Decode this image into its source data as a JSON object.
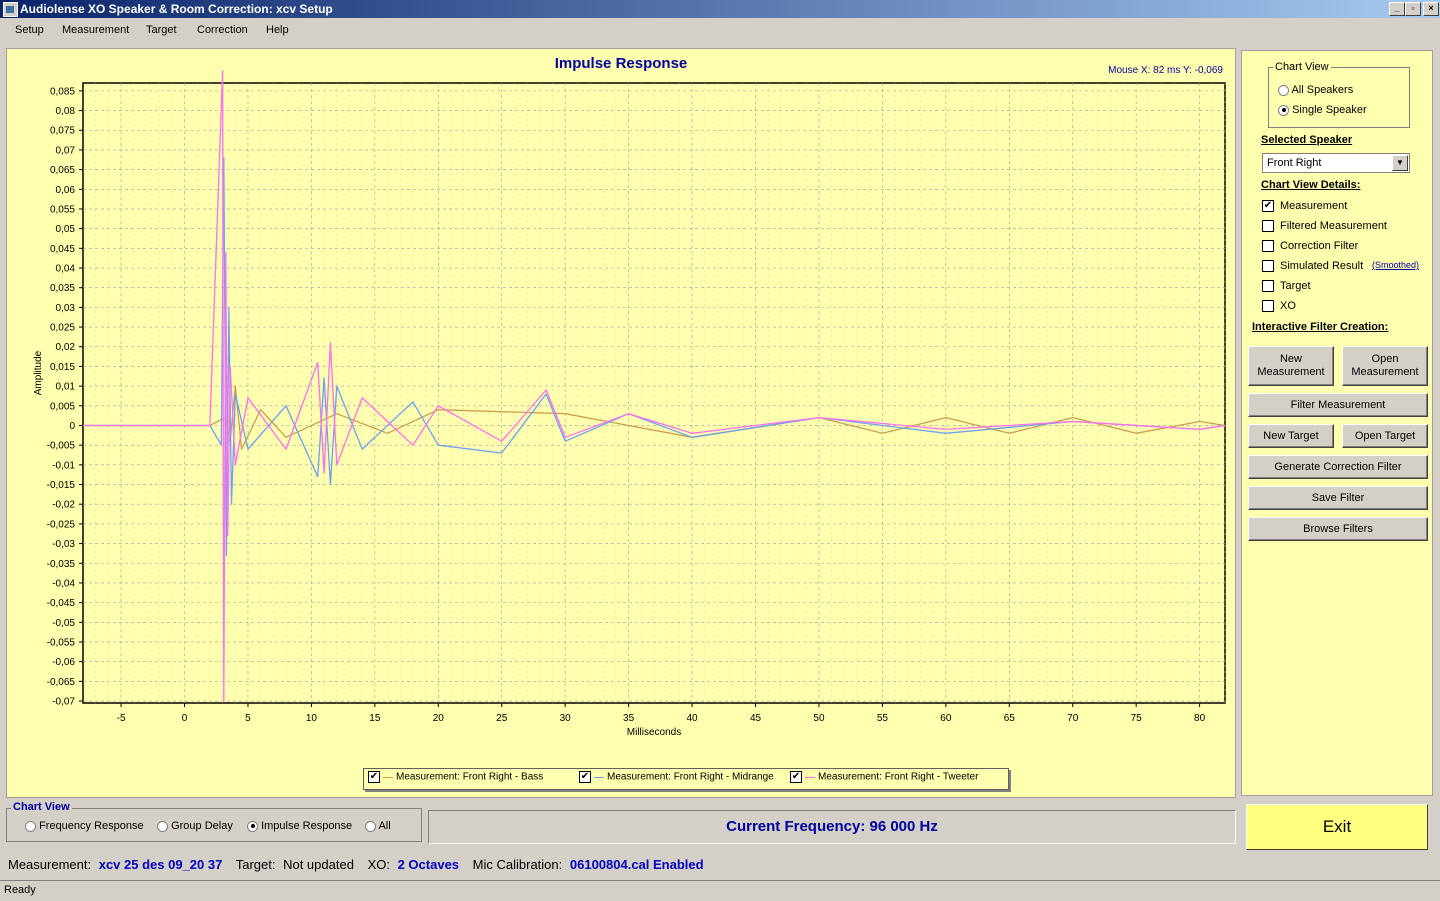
{
  "window": {
    "title": "Audiolense XO Speaker & Room Correction: xcv Setup"
  },
  "menu": {
    "items": [
      "Setup",
      "Measurement",
      "Target",
      "Correction",
      "Help"
    ]
  },
  "chart": {
    "title": "Impulse Response",
    "mouse_readout": "Mouse X: 82 ms   Y: -0,069"
  },
  "chart_data": {
    "type": "line",
    "title": "Impulse Response",
    "xlabel": "Milliseconds",
    "ylabel": "Amplitude",
    "xlim": [
      -8,
      82
    ],
    "ylim": [
      -0.07,
      0.085
    ],
    "grid": true,
    "xticks": [
      "-5",
      "0",
      "5",
      "10",
      "15",
      "20",
      "25",
      "30",
      "35",
      "40",
      "45",
      "50",
      "55",
      "60",
      "65",
      "70",
      "75",
      "80"
    ],
    "yticks": [
      "0,085",
      "0,08",
      "0,075",
      "0,07",
      "0,065",
      "0,06",
      "0,055",
      "0,05",
      "0,045",
      "0,04",
      "0,035",
      "0,03",
      "0,025",
      "0,02",
      "0,015",
      "0,01",
      "0,005",
      "0",
      "-0,005",
      "-0,01",
      "-0,015",
      "-0,02",
      "-0,025",
      "-0,03",
      "-0,035",
      "-0,04",
      "-0,045",
      "-0,05",
      "-0,055",
      "-0,06",
      "-0,065",
      "-0,07"
    ],
    "series": [
      {
        "name": "Measurement: Front Right - Bass",
        "color": "#c8a050",
        "x": [
          -8,
          2,
          3.2,
          3.6,
          4,
          4.5,
          6,
          8,
          12,
          16,
          20,
          30,
          40,
          50,
          55,
          60,
          65,
          70,
          75,
          80,
          82
        ],
        "y": [
          0,
          0,
          0.002,
          -0.004,
          0.01,
          -0.006,
          0.004,
          -0.003,
          0.003,
          -0.002,
          0.004,
          0.003,
          -0.003,
          0.002,
          -0.002,
          0.002,
          -0.002,
          0.002,
          -0.002,
          0.001,
          0
        ]
      },
      {
        "name": "Measurement: Front Right - Midrange",
        "color": "#70a0f0",
        "x": [
          -8,
          2,
          2.9,
          3.1,
          3.3,
          3.5,
          3.7,
          4,
          5,
          8,
          10.5,
          11,
          11.5,
          12,
          14,
          18,
          20,
          25,
          28.5,
          30,
          35,
          40,
          50,
          60,
          70,
          80,
          82
        ],
        "y": [
          0,
          0,
          -0.005,
          0.068,
          -0.033,
          0.03,
          -0.02,
          0.008,
          -0.006,
          0.005,
          -0.013,
          0.012,
          -0.015,
          0.01,
          -0.006,
          0.006,
          -0.005,
          -0.007,
          0.008,
          -0.004,
          0.003,
          -0.003,
          0.002,
          -0.002,
          0.001,
          -0.001,
          0
        ]
      },
      {
        "name": "Measurement: Front Right - Tweeter",
        "color": "#ff70f0",
        "x": [
          -8,
          2,
          3.0,
          3.1,
          3.25,
          3.4,
          3.6,
          4,
          5,
          8,
          10.5,
          11,
          11.5,
          12,
          14,
          18,
          20,
          25,
          28.5,
          30,
          35,
          40,
          50,
          60,
          70,
          80,
          82
        ],
        "y": [
          0,
          0,
          0.09,
          -0.07,
          0.044,
          -0.028,
          0.015,
          -0.01,
          0.007,
          -0.006,
          0.016,
          -0.012,
          0.021,
          -0.01,
          0.007,
          -0.005,
          0.005,
          -0.004,
          0.009,
          -0.003,
          0.003,
          -0.002,
          0.002,
          -0.001,
          0.001,
          -0.001,
          0
        ]
      }
    ]
  },
  "legend": {
    "items": [
      {
        "label": "Measurement: Front Right - Bass",
        "checked": "✔"
      },
      {
        "label": "Measurement: Front Right - Midrange",
        "checked": "✔"
      },
      {
        "label": "Measurement: Front Right - Tweeter",
        "checked": "✔"
      }
    ]
  },
  "right_panel": {
    "chart_view_label": "Chart View",
    "all_speakers": "All Speakers",
    "single_speaker": "Single Speaker",
    "selected_speaker_label": "Selected Speaker",
    "selected_speaker_value": "Front Right",
    "chart_view_details_label": "Chart View Details:",
    "details": [
      {
        "label": "Measurement",
        "checked": "✔"
      },
      {
        "label": "Filtered Measurement",
        "checked": ""
      },
      {
        "label": "Correction Filter",
        "checked": ""
      },
      {
        "label": "Simulated Result",
        "checked": ""
      },
      {
        "label": "Target",
        "checked": ""
      },
      {
        "label": "XO",
        "checked": ""
      }
    ],
    "smoothed_link": "(Smoothed)",
    "interactive_label": "Interactive Filter Creation:",
    "buttons": {
      "new_measurement": "New Measurement",
      "open_measurement": "Open Measurement",
      "filter_measurement": "Filter Measurement",
      "new_target": "New Target",
      "open_target": "Open Target",
      "generate_correction_filter": "Generate Correction Filter",
      "save_filter": "Save Filter",
      "browse_filters": "Browse Filters"
    }
  },
  "bottom": {
    "chart_view_label": "Chart View",
    "options": [
      "Frequency Response",
      "Group Delay",
      "Impulse Response",
      "All"
    ],
    "current_frequency": "Current Frequency: 96 000 Hz",
    "exit_label": "Exit"
  },
  "status_info": {
    "measurement_label": "Measurement:",
    "measurement_value": "xcv 25 des 09_20 37",
    "target_label": "Target:",
    "target_value": "Not updated",
    "xo_label": "XO:",
    "xo_value": "2 Octaves",
    "mic_label": "Mic Calibration:",
    "mic_value": "06100804.cal Enabled"
  },
  "status_bar": {
    "text": "Ready"
  }
}
